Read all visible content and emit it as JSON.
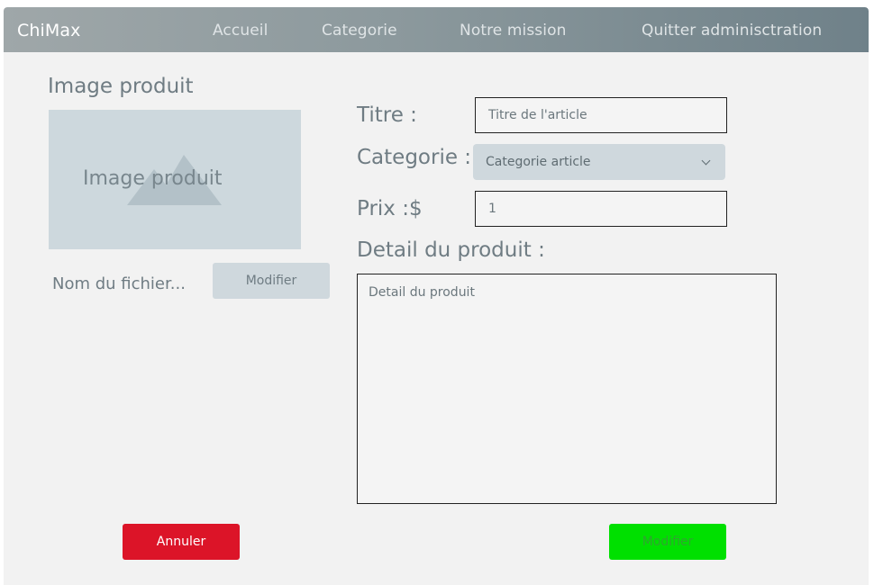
{
  "nav": {
    "brand": "ChiMax",
    "items": [
      "Accueil",
      "Categorie",
      "Notre mission",
      "Quitter adminisctration"
    ]
  },
  "image_section": {
    "heading": "Image produit",
    "placeholder_caption": "Image produit",
    "file_name": "Nom du fichier...",
    "modify_label": "Modifier"
  },
  "form": {
    "title_label": "Titre :",
    "title_placeholder": "Titre de l'article",
    "category_label": "Categorie :",
    "category_selected": "Categorie article",
    "price_label": "Prix :$",
    "price_value": "1",
    "detail_label": "Detail du produit :",
    "detail_placeholder": "Detail du produit"
  },
  "actions": {
    "cancel_label": "Annuler",
    "submit_label": "Modifier"
  },
  "colors": {
    "cancel": "#dc1428",
    "submit": "#00e000",
    "secondary_button": "#cfd8dd"
  }
}
